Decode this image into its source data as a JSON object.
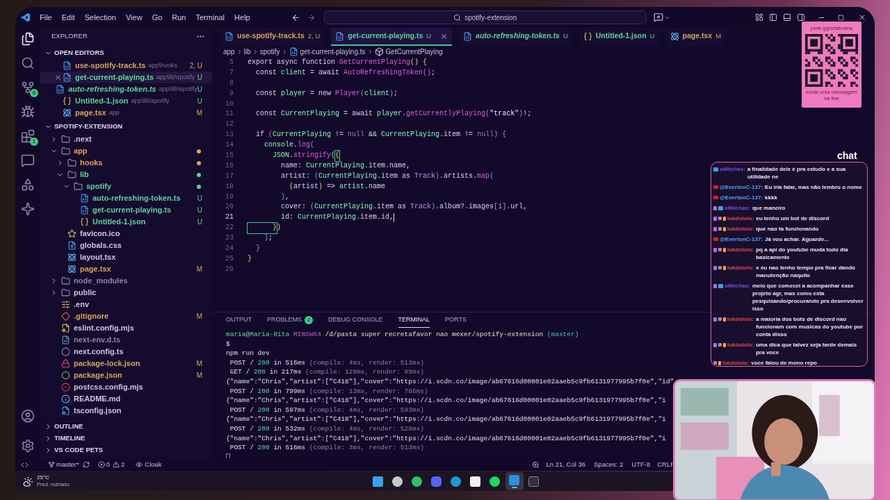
{
  "title_bar": {
    "menu": [
      "File",
      "Edit",
      "Selection",
      "View",
      "Go",
      "Run",
      "Terminal",
      "Help"
    ],
    "search": "spotify-extension"
  },
  "activity": [
    {
      "kind": "files",
      "selected": true
    },
    {
      "kind": "search",
      "selected": false
    },
    {
      "kind": "source-control",
      "selected": false,
      "badge": "8"
    },
    {
      "kind": "run",
      "selected": false
    },
    {
      "kind": "extensions",
      "selected": false,
      "badge": "1"
    },
    {
      "kind": "chat",
      "selected": false
    },
    {
      "kind": "shapes",
      "selected": false
    },
    {
      "kind": "sparkle",
      "selected": false
    }
  ],
  "activity_bottom": [
    {
      "kind": "account"
    },
    {
      "kind": "settings"
    }
  ],
  "explorer": {
    "title": "EXPLORER",
    "open_editors_title": "OPEN EDITORS",
    "open_editors": [
      {
        "name": "use-spotify-track.ts",
        "path": "app\\hooks",
        "status": "2, U",
        "kind": "ts",
        "color": "#d9a55a",
        "italic": false,
        "selected": false
      },
      {
        "name": "get-current-playing.ts",
        "path": "app\\lib\\spotify",
        "status": "U",
        "kind": "ts",
        "color": "#5fd39a",
        "italic": false,
        "selected": true
      },
      {
        "name": "auto-refreshing-token.ts",
        "path": "app\\lib\\spotify",
        "status": "U",
        "kind": "ts",
        "color": "#5fd39a",
        "italic": true,
        "selected": false
      },
      {
        "name": "Untitled-1.json",
        "path": "app\\lib\\spotify",
        "status": "U",
        "kind": "json",
        "color": "#5fd39a",
        "italic": false,
        "selected": false
      },
      {
        "name": "page.tsx",
        "path": "app",
        "status": "M",
        "kind": "react",
        "color": "#d9a55a",
        "italic": false,
        "selected": false
      }
    ],
    "project_title": "SPOTIFY-EXTENSION",
    "tree": [
      {
        "name": ".next",
        "kind": "folder",
        "expanded": false,
        "color": "#cfc6e0"
      },
      {
        "name": "app",
        "kind": "folder",
        "expanded": true,
        "color": "#d9a55a",
        "dot": true,
        "children": [
          {
            "name": "hooks",
            "kind": "folder",
            "expanded": false,
            "color": "#d9a55a",
            "dot": true
          },
          {
            "name": "lib",
            "kind": "folder",
            "expanded": true,
            "color": "#5fd39a",
            "dot": true,
            "children": [
              {
                "name": "spotify",
                "kind": "folder",
                "expanded": true,
                "color": "#5fd39a",
                "dot": true,
                "children": [
                  {
                    "name": "auto-refreshing-token.ts",
                    "kind": "ts",
                    "color": "#5fd39a",
                    "status": "U"
                  },
                  {
                    "name": "get-current-playing.ts",
                    "kind": "ts",
                    "color": "#5fd39a",
                    "status": "U"
                  },
                  {
                    "name": "Untitled-1.json",
                    "kind": "json",
                    "color": "#5fd39a",
                    "status": "U"
                  }
                ]
              }
            ]
          },
          {
            "name": "favicon.ico",
            "kind": "star",
            "color": "#cfc6e0"
          },
          {
            "name": "globals.css",
            "kind": "css",
            "color": "#cfc6e0"
          },
          {
            "name": "layout.tsx",
            "kind": "react",
            "color": "#cfc6e0"
          },
          {
            "name": "page.tsx",
            "kind": "react",
            "color": "#d9a55a",
            "status": "M"
          }
        ]
      },
      {
        "name": "node_modules",
        "kind": "folder",
        "expanded": false,
        "color": "#8e86a0"
      },
      {
        "name": "public",
        "kind": "folder",
        "expanded": false,
        "color": "#cfc6e0"
      },
      {
        "name": ".env",
        "kind": "env",
        "color": "#cfc6e0"
      },
      {
        "name": ".gitignore",
        "kind": "git",
        "color": "#d9a55a",
        "status": "M"
      },
      {
        "name": "eslint.config.mjs",
        "kind": "config",
        "color": "#cfc6e0"
      },
      {
        "name": "next-env.d.ts",
        "kind": "dts",
        "color": "#8e86a0"
      },
      {
        "name": "next.config.ts",
        "kind": "next",
        "color": "#cfc6e0"
      },
      {
        "name": "package-lock.json",
        "kind": "lock",
        "color": "#d9a55a",
        "status": "M"
      },
      {
        "name": "package.json",
        "kind": "npm",
        "color": "#d9a55a",
        "status": "M"
      },
      {
        "name": "postcss.config.mjs",
        "kind": "postcss",
        "color": "#cfc6e0"
      },
      {
        "name": "README.md",
        "kind": "info",
        "color": "#cfc6e0"
      },
      {
        "name": "tsconfig.json",
        "kind": "tsconfig",
        "color": "#cfc6e0"
      }
    ],
    "sections": [
      "OUTLINE",
      "TIMELINE",
      "VS CODE PETS"
    ]
  },
  "tabs": [
    {
      "name": "use-spotify-track.ts",
      "status": "2, U",
      "kind": "ts",
      "color": "#d9a55a",
      "italic": false,
      "selected": false
    },
    {
      "name": "get-current-playing.ts",
      "status": "U",
      "kind": "ts",
      "color": "#5fd39a",
      "italic": false,
      "selected": true
    },
    {
      "name": "auto-refreshing-token.ts",
      "status": "U",
      "kind": "ts",
      "color": "#5fd39a",
      "italic": true,
      "selected": false
    },
    {
      "name": "Untitled-1.json",
      "status": "U",
      "kind": "json",
      "color": "#5fd39a",
      "italic": false,
      "selected": false
    },
    {
      "name": "page.tsx",
      "status": "M",
      "kind": "react",
      "color": "#d9a55a",
      "italic": false,
      "selected": false
    }
  ],
  "breadcrumb": [
    {
      "text": "app",
      "kind": "folder"
    },
    {
      "text": "lib",
      "kind": "folder"
    },
    {
      "text": "spotify",
      "kind": "folder"
    },
    {
      "text": "get-current-playing.ts",
      "kind": "ts"
    },
    {
      "text": "GetCurrentPlaying",
      "kind": "symbol"
    }
  ],
  "code": [
    {
      "num": "5",
      "active": false,
      "tokens": [
        {
          "kind": "kw",
          "t": "export async function "
        },
        {
          "kind": "fn",
          "t": "GetCurrentPlaying"
        },
        {
          "kind": "b1",
          "t": "() {"
        }
      ]
    },
    {
      "num": "7",
      "active": false,
      "tokens": [
        {
          "kind": "kw",
          "t": "  const "
        },
        {
          "kind": "var",
          "t": "client"
        },
        {
          "kind": "kw",
          "t": " = await "
        },
        {
          "kind": "fn",
          "t": "AutoRefreshingToken"
        },
        {
          "kind": "b2",
          "t": "()"
        },
        {
          "kind": "kw",
          "t": ";"
        }
      ]
    },
    {
      "num": "8",
      "active": false
    },
    {
      "num": "9",
      "active": false,
      "tokens": [
        {
          "kind": "kw",
          "t": "  const "
        },
        {
          "kind": "var",
          "t": "player"
        },
        {
          "kind": "kw",
          "t": " = new "
        },
        {
          "kind": "fn",
          "t": "Player"
        },
        {
          "kind": "b2",
          "t": "("
        },
        {
          "kind": "var",
          "t": "client"
        },
        {
          "kind": "b2",
          "t": ")"
        },
        {
          "kind": "kw",
          "t": ";"
        }
      ]
    },
    {
      "num": "10",
      "active": false
    },
    {
      "num": "11",
      "active": false,
      "tokens": [
        {
          "kind": "kw",
          "t": "  const "
        },
        {
          "kind": "var",
          "t": "CurrentPlaying"
        },
        {
          "kind": "kw",
          "t": " = await "
        },
        {
          "kind": "var",
          "t": "player"
        },
        {
          "kind": "kw",
          "t": "."
        },
        {
          "kind": "fn",
          "t": "getCurrentlyPlaying"
        },
        {
          "kind": "b2",
          "t": "("
        },
        {
          "kind": "str",
          "t": "\"track\""
        },
        {
          "kind": "b2",
          "t": ")"
        },
        {
          "kind": "kw",
          "t": "!;"
        }
      ]
    },
    {
      "num": "12",
      "active": false
    },
    {
      "num": "13",
      "active": false,
      "tokens": [
        {
          "kind": "kw",
          "t": "  if "
        },
        {
          "kind": "b2",
          "t": "("
        },
        {
          "kind": "var",
          "t": "CurrentPlaying"
        },
        {
          "kind": "kw",
          "t": " != "
        },
        {
          "kind": "null",
          "t": "null"
        },
        {
          "kind": "kw",
          "t": " && "
        },
        {
          "kind": "var",
          "t": "CurrentPlaying"
        },
        {
          "kind": "kw",
          "t": ".item != "
        },
        {
          "kind": "null",
          "t": "null"
        },
        {
          "kind": "b2",
          "t": ") {"
        }
      ]
    },
    {
      "num": "14",
      "active": false,
      "tokens": [
        {
          "kind": "var",
          "t": "    console"
        },
        {
          "kind": "kw",
          "t": "."
        },
        {
          "kind": "fn",
          "t": "log"
        },
        {
          "kind": "b3",
          "t": "("
        }
      ]
    },
    {
      "num": "15",
      "active": false,
      "tokens": [
        {
          "kind": "var",
          "t": "      JSON"
        },
        {
          "kind": "kw",
          "t": "."
        },
        {
          "kind": "fn",
          "t": "stringify"
        },
        {
          "kind": "b1",
          "t": "("
        },
        {
          "kind": "match",
          "t": "{"
        }
      ]
    },
    {
      "num": "16",
      "active": false,
      "tokens": [
        {
          "kind": "kw",
          "t": "        name: "
        },
        {
          "kind": "var",
          "t": "CurrentPlaying"
        },
        {
          "kind": "kw",
          "t": ".item.name,"
        }
      ]
    },
    {
      "num": "17",
      "active": false,
      "tokens": [
        {
          "kind": "kw",
          "t": "        artist: "
        },
        {
          "kind": "b3",
          "t": "("
        },
        {
          "kind": "var",
          "t": "CurrentPlaying"
        },
        {
          "kind": "kw",
          "t": ".item as "
        },
        {
          "kind": "type",
          "t": "Track"
        },
        {
          "kind": "b3",
          "t": ")"
        },
        {
          "kind": "kw",
          "t": ".artists."
        },
        {
          "kind": "fn",
          "t": "map"
        },
        {
          "kind": "b3",
          "t": "("
        }
      ]
    },
    {
      "num": "18",
      "active": false,
      "tokens": [
        {
          "kind": "b1",
          "t": "          ("
        },
        {
          "kind": "kw",
          "t": "artist"
        },
        {
          "kind": "b1",
          "t": ")"
        },
        {
          "kind": "kw",
          "t": " => "
        },
        {
          "kind": "var",
          "t": "artist"
        },
        {
          "kind": "kw",
          "t": ".name"
        }
      ]
    },
    {
      "num": "19",
      "active": false,
      "tokens": [
        {
          "kind": "b3",
          "t": "        )"
        },
        {
          "kind": "kw",
          "t": ","
        }
      ]
    },
    {
      "num": "20",
      "active": false,
      "tokens": [
        {
          "kind": "kw",
          "t": "        cover: "
        },
        {
          "kind": "b3",
          "t": "("
        },
        {
          "kind": "var",
          "t": "CurrentPlaying"
        },
        {
          "kind": "kw",
          "t": ".item as "
        },
        {
          "kind": "type",
          "t": "Track"
        },
        {
          "kind": "b3",
          "t": ")"
        },
        {
          "kind": "kw",
          "t": ".album?.images"
        },
        {
          "kind": "b3",
          "t": "["
        },
        {
          "kind": "num",
          "t": "1"
        },
        {
          "kind": "b3",
          "t": "]"
        },
        {
          "kind": "kw",
          "t": ".url,"
        }
      ]
    },
    {
      "num": "21",
      "active": true,
      "tokens": [
        {
          "kind": "kw",
          "t": "        id: "
        },
        {
          "kind": "var",
          "t": "CurrentPlaying"
        },
        {
          "kind": "kw",
          "t": ".item.id,"
        }
      ]
    },
    {
      "num": "22",
      "active": false,
      "tokens": [
        {
          "kind": "match",
          "t": "      }"
        },
        {
          "kind": "b1",
          "t": ")"
        }
      ]
    },
    {
      "num": "23",
      "active": false,
      "tokens": [
        {
          "kind": "b3",
          "t": "    )"
        },
        {
          "kind": "kw",
          "t": ";"
        }
      ]
    },
    {
      "num": "24",
      "active": false,
      "tokens": [
        {
          "kind": "b2",
          "t": "  }"
        }
      ]
    },
    {
      "num": "25",
      "active": false,
      "tokens": [
        {
          "kind": "b1",
          "t": "}"
        }
      ]
    },
    {
      "num": "26",
      "active": false
    }
  ],
  "panel_tabs": [
    {
      "label": "OUTPUT",
      "selected": false
    },
    {
      "label": "PROBLEMS",
      "selected": false,
      "badge": "2"
    },
    {
      "label": "DEBUG CONSOLE",
      "selected": false
    },
    {
      "label": "TERMINAL",
      "selected": true
    },
    {
      "label": "PORTS",
      "selected": false
    }
  ],
  "terminal": {
    "prompt_cursor": true,
    "lines": [
      [
        {
          "kind": "user",
          "t": "maria@Maria-Rita"
        },
        {
          "kind": "host",
          "t": " MINGW64"
        },
        {
          "kind": "path",
          "t": " /d/pasta super recretafavor nao mexer/spotify-extension"
        },
        {
          "kind": "branch",
          "t": " (master)"
        }
      ],
      [
        {
          "kind": "plain",
          "t": "$"
        }
      ],
      [
        {
          "kind": "plain",
          "t": "npm run dev"
        }
      ],
      [
        {
          "kind": "plain",
          "t": " POST / "
        },
        {
          "kind": "ok",
          "t": "200"
        },
        {
          "kind": "plain",
          "t": " in 516ms "
        },
        {
          "kind": "dim",
          "t": "(compile: 4ms, render: 513ms)"
        }
      ],
      [
        {
          "kind": "plain",
          "t": " GET / "
        },
        {
          "kind": "ok",
          "t": "200"
        },
        {
          "kind": "plain",
          "t": " in 217ms "
        },
        {
          "kind": "dim",
          "t": "(compile: 128ms, render: 89ms)"
        }
      ],
      [
        {
          "kind": "plain",
          "t": "{\"name\":\"Chris\",\"artist\":[\"C418\"],\"cover\":\"https://i.scdn.co/image/ab67616d00001e02aaeb5c9fb6131977995b7f0e\",\"id\""
        }
      ],
      [
        {
          "kind": "plain",
          "t": " POST / "
        },
        {
          "kind": "ok",
          "t": "200"
        },
        {
          "kind": "plain",
          "t": " in 799ms "
        },
        {
          "kind": "dim",
          "t": "(compile: 13ms, render: 786ms)"
        }
      ],
      [
        {
          "kind": "plain",
          "t": "{\"name\":\"Chris\",\"artist\":[\"C418\"],\"cover\":\"https://i.scdn.co/image/ab67616d00001e02aaeb5c9fb6131977995b7f0e\",\"i"
        }
      ],
      [
        {
          "kind": "plain",
          "t": " POST / "
        },
        {
          "kind": "ok",
          "t": "200"
        },
        {
          "kind": "plain",
          "t": " in 597ms "
        },
        {
          "kind": "dim",
          "t": "(compile: 4ms, render: 593ms)"
        }
      ],
      [
        {
          "kind": "plain",
          "t": "{\"name\":\"Chris\",\"artist\":[\"C418\"],\"cover\":\"https://i.scdn.co/image/ab67616d00001e02aaeb5c9fb6131977995b7f0e\",\"i"
        }
      ],
      [
        {
          "kind": "plain",
          "t": " POST / "
        },
        {
          "kind": "ok",
          "t": "200"
        },
        {
          "kind": "plain",
          "t": " in 532ms "
        },
        {
          "kind": "dim",
          "t": "(compile: 4ms, render: 528ms)"
        }
      ],
      [
        {
          "kind": "plain",
          "t": "{\"name\":\"Chris\",\"artist\":[\"C418\"],\"cover\":\"https://i.scdn.co/image/ab67616d00001e02aaeb5c9fb6131977995b7f0e\",\"i"
        }
      ],
      [
        {
          "kind": "plain",
          "t": " POST / "
        },
        {
          "kind": "ok",
          "t": "200"
        },
        {
          "kind": "plain",
          "t": " in 516ms "
        },
        {
          "kind": "dim",
          "t": "(compile: 3ms, render: 513ms)"
        }
      ]
    ]
  },
  "status_bar": {
    "branch": "master*",
    "errors": "0",
    "warnings": "2",
    "extension": "Cloak",
    "position": "Ln 21, Col 36",
    "spaces": "Spaces: 2",
    "encoding": "UTF-8",
    "eol": "CRLF"
  },
  "taskbar": {
    "temperature": "25°C",
    "forecast": "Pred. nublado",
    "apps": [
      {
        "kind": "start",
        "selected": false
      },
      {
        "kind": "browser",
        "selected": false
      },
      {
        "kind": "phone",
        "selected": false
      },
      {
        "kind": "game",
        "selected": false
      },
      {
        "kind": "wave",
        "selected": false
      },
      {
        "kind": "notes",
        "selected": false
      },
      {
        "kind": "music",
        "selected": false
      },
      {
        "kind": "editor",
        "selected": true
      },
      {
        "kind": "terminal",
        "selected": false
      }
    ]
  },
  "qr_card": {
    "url": "pixie.gg/criativaria",
    "caption": "envie uma mensagem na live"
  },
  "chat": {
    "title": "chat",
    "messages": [
      {
        "badges": [
          {
            "kind": "camera"
          }
        ],
        "user": "oMiichas:",
        "color": "#7a4ce0",
        "text": "a finalidade dele é pra estudo e a sua utilidade ne"
      },
      {
        "badges": [
          {
            "kind": "youtube"
          }
        ],
        "user": "@EvertonC-137:",
        "color": "#4aa8f0",
        "text": "Eu iria falar, mas não lembro o nome"
      },
      {
        "badges": [
          {
            "kind": "youtube"
          }
        ],
        "user": "@EvertonC-137:",
        "color": "#4aa8f0",
        "text": "kkkk"
      },
      {
        "badges": [
          {
            "kind": "twitch"
          },
          {
            "kind": "camera"
          }
        ],
        "user": "oMiichas:",
        "color": "#7a4ce0",
        "text": "que maneiro"
      },
      {
        "badges": [
          {
            "kind": "twitch"
          },
          {
            "kind": "gift"
          },
          {
            "kind": "tool"
          }
        ],
        "user": "lukdololo:",
        "color": "#e04848",
        "text": "eu tenho um bot de discord"
      },
      {
        "badges": [
          {
            "kind": "twitch"
          },
          {
            "kind": "gift"
          },
          {
            "kind": "tool"
          }
        ],
        "user": "lukdololo:",
        "color": "#e04848",
        "text": "que nao ta funcionando"
      },
      {
        "badges": [
          {
            "kind": "youtube"
          }
        ],
        "user": "@EvertonC-137:",
        "color": "#4aa8f0",
        "text": "Já vou achar. Aguarde..."
      },
      {
        "badges": [
          {
            "kind": "twitch"
          },
          {
            "kind": "gift"
          },
          {
            "kind": "tool"
          }
        ],
        "user": "lukdololo:",
        "color": "#e04848",
        "text": "pq a api do youtube muda todo dia basicamente"
      },
      {
        "badges": [
          {
            "kind": "twitch"
          },
          {
            "kind": "gift"
          },
          {
            "kind": "tool"
          }
        ],
        "user": "lukdololo:",
        "color": "#e04848",
        "text": "e eu nao tenho tempo pra ficar dando manutenção naquilo"
      },
      {
        "badges": [
          {
            "kind": "twitch"
          },
          {
            "kind": "camera"
          }
        ],
        "user": "oMiichas:",
        "color": "#7a4ce0",
        "text": "meio que comecei a acompanhar esse projeto agr, mas como esta pesquisando/procurando pra desenvolver isso"
      },
      {
        "badges": [
          {
            "kind": "twitch"
          },
          {
            "kind": "gift"
          },
          {
            "kind": "tool"
          }
        ],
        "user": "lukdololo:",
        "color": "#e04848",
        "text": "a maioria dos bots de discord nao funcionam com musicas do youtube por conta disso"
      },
      {
        "badges": [
          {
            "kind": "twitch"
          },
          {
            "kind": "gift"
          },
          {
            "kind": "tool"
          }
        ],
        "user": "lukdololo:",
        "color": "#e04848",
        "text": "uma dica que talvez seja tarde demais pra voce"
      },
      {
        "badges": [
          {
            "kind": "gift"
          },
          {
            "kind": "tool"
          }
        ],
        "user": "lukdololo:",
        "color": "#e04848",
        "text": "voce falou de mono repo"
      }
    ]
  }
}
